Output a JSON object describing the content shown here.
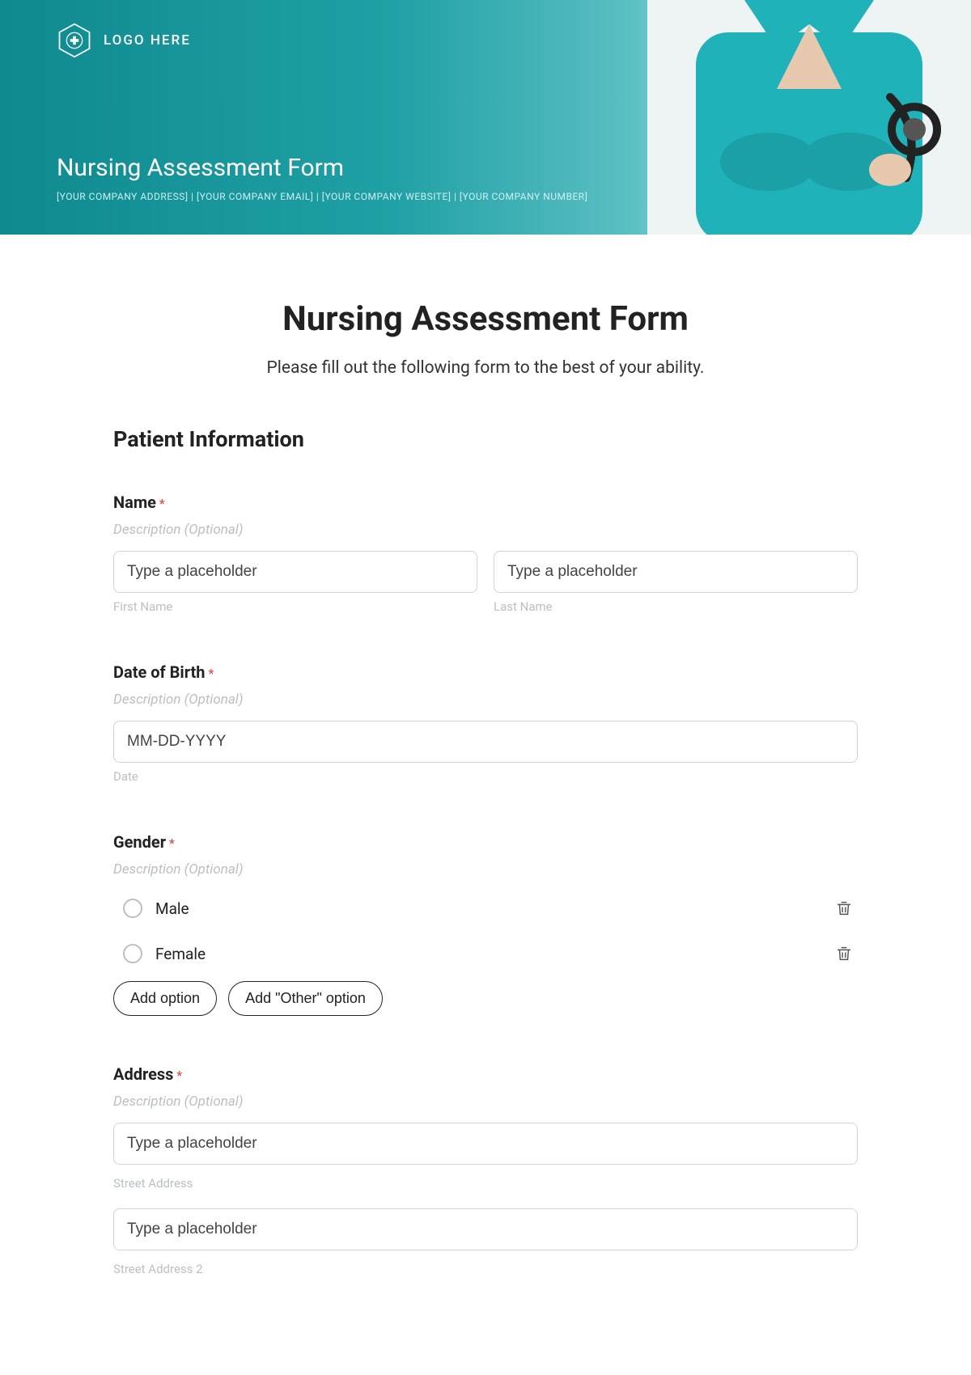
{
  "header": {
    "logo_text": "LOGO HERE",
    "title": "Nursing Assessment Form",
    "sub": "[YOUR COMPANY ADDRESS]  |  [YOUR COMPANY EMAIL]  |  [YOUR COMPANY WEBSITE]  |  [YOUR COMPANY NUMBER]"
  },
  "form": {
    "title": "Nursing Assessment Form",
    "intro": "Please fill out the following form to the best of your ability.",
    "section1_heading": "Patient Information",
    "name": {
      "label": "Name",
      "required": "*",
      "desc": "Description (Optional)",
      "first_placeholder": "Type a placeholder",
      "first_sub": "First Name",
      "last_placeholder": "Type a placeholder",
      "last_sub": "Last Name"
    },
    "dob": {
      "label": "Date of Birth",
      "required": "*",
      "desc": "Description (Optional)",
      "placeholder": "MM-DD-YYYY",
      "sub": "Date"
    },
    "gender": {
      "label": "Gender",
      "required": "*",
      "desc": "Description (Optional)",
      "opt1": "Male",
      "opt2": "Female",
      "add_option": "Add option",
      "add_other": "Add \"Other\" option"
    },
    "address": {
      "label": "Address",
      "required": "*",
      "desc": "Description (Optional)",
      "street1_placeholder": "Type a placeholder",
      "street1_sub": "Street Address",
      "street2_placeholder": "Type a placeholder",
      "street2_sub": "Street Address 2"
    }
  }
}
